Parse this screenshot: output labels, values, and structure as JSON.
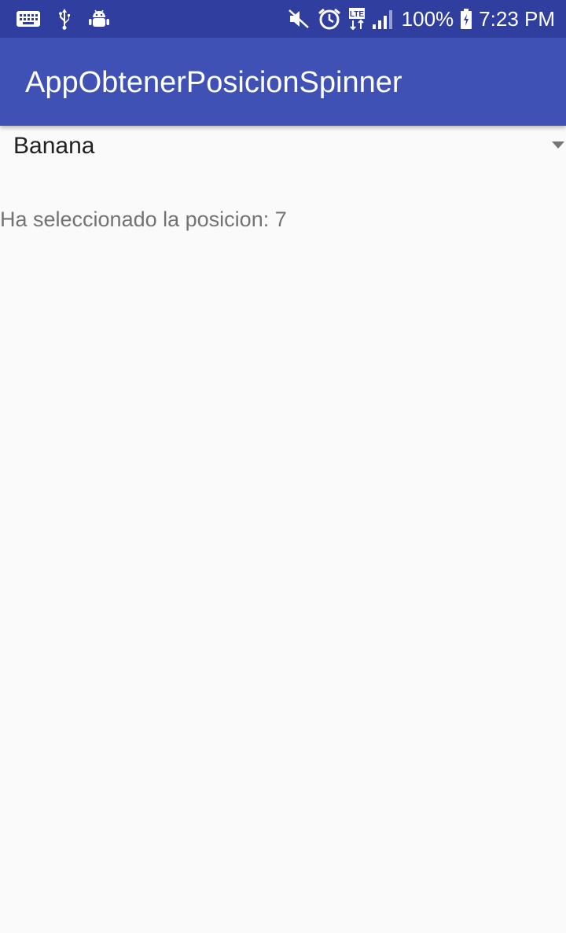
{
  "status_bar": {
    "icons_left": [
      "keyboard-icon",
      "usb-icon",
      "android-debug-icon"
    ],
    "icons_right": [
      "mute-icon",
      "alarm-icon",
      "lte-icon",
      "signal-icon",
      "battery-charging-icon"
    ],
    "battery_percent": "100%",
    "time": "7:23 PM",
    "colors": {
      "background": "#303f9f",
      "foreground": "#ffffff"
    }
  },
  "app_bar": {
    "title": "AppObtenerPosicionSpinner",
    "color": "#3f51b5"
  },
  "spinner": {
    "selected_value": "Banana",
    "arrow_icon": "dropdown-triangle-icon"
  },
  "result": {
    "text": "Ha seleccionado la posicion: 7"
  }
}
